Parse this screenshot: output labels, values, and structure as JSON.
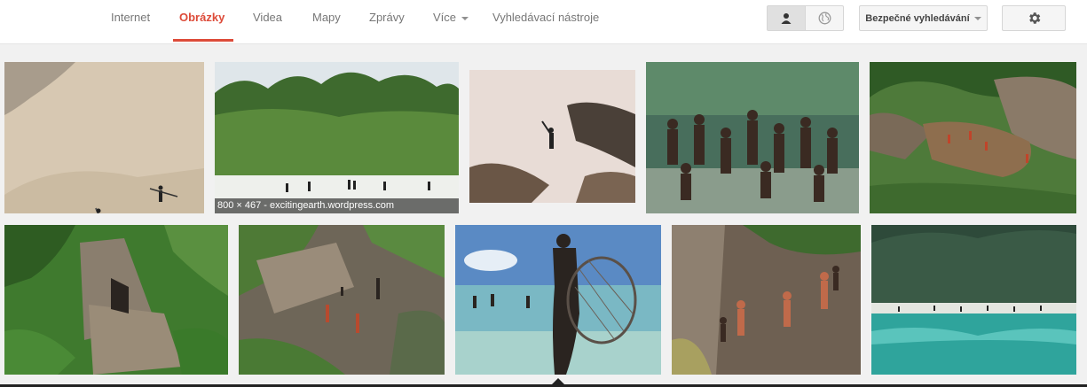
{
  "nav": {
    "tabs": [
      {
        "label": "Internet"
      },
      {
        "label": "Obrázky"
      },
      {
        "label": "Videa"
      },
      {
        "label": "Mapy"
      },
      {
        "label": "Zprávy"
      },
      {
        "label": "Více"
      },
      {
        "label": "Vyhledávací nástroje"
      }
    ],
    "active_tab": "Obrázky",
    "accent_color": "#dd4b39"
  },
  "toolbar": {
    "personal_icon": "person-icon",
    "public_icon": "globe-icon",
    "safe_search_label": "Bezpečné vyhledávání",
    "settings_icon": "gear-icon"
  },
  "results": {
    "hover_caption": "800 × 467 - excitingearth.wordpress.com",
    "images": [
      {
        "subject": "sandy beach aerial with two figures"
      },
      {
        "subject": "forest edge with white beach"
      },
      {
        "subject": "man on rocky shore"
      },
      {
        "subject": "group portrait in forest"
      },
      {
        "subject": "aerial huts in clearing"
      },
      {
        "subject": "thatched hut in jungle aerial"
      },
      {
        "subject": "people near hut aerial"
      },
      {
        "subject": "woman with fishing net in sea"
      },
      {
        "subject": "people in clearing aerial"
      },
      {
        "subject": "island coast with turquoise sea"
      }
    ]
  }
}
